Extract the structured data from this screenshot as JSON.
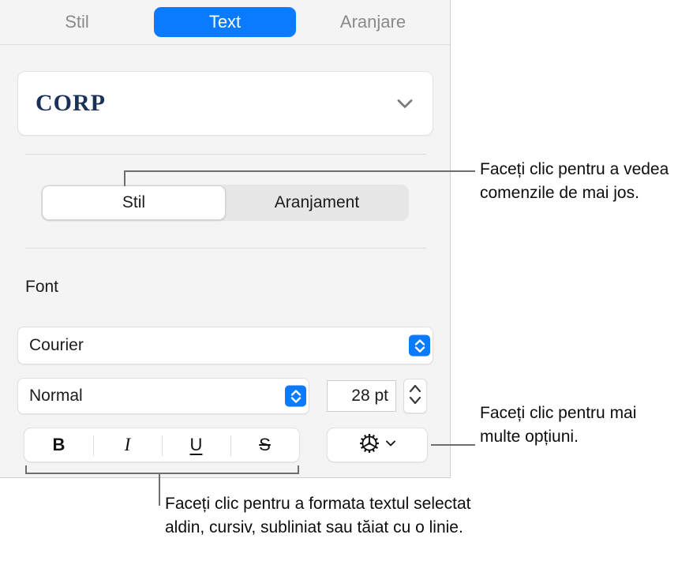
{
  "panel": {
    "tabs": [
      {
        "label": "Stil",
        "selected": false
      },
      {
        "label": "Text",
        "selected": true
      },
      {
        "label": "Aranjare",
        "selected": false
      }
    ],
    "paragraph_style": {
      "value": "CORP",
      "chevron_icon": "chevron-down-icon"
    },
    "segmented_control": [
      {
        "label": "Stil",
        "selected": true
      },
      {
        "label": "Aranjament",
        "selected": false
      }
    ],
    "font_section": {
      "heading": "Font",
      "family": "Courier",
      "style": "Normal",
      "size": "28 pt",
      "family_arrows_icon": "up-down-chevron-icon",
      "style_arrows_icon": "up-down-chevron-icon",
      "size_stepper_icon": "stepper-up-down-icon"
    },
    "text_style_buttons": [
      {
        "name": "bold",
        "glyph": "B"
      },
      {
        "name": "italic",
        "glyph": "I"
      },
      {
        "name": "underline",
        "glyph": "U"
      },
      {
        "name": "strikethrough",
        "glyph": "S"
      }
    ],
    "more_options": {
      "icon": "gear-icon",
      "chevron_icon": "chevron-down-icon"
    }
  },
  "callouts": {
    "top": "Faceți clic pentru a vedea comenzile de mai jos.",
    "right": "Faceți clic pentru mai multe opțiuni.",
    "bottom": "Faceți clic pentru a formata textul selectat aldin, cursiv, subliniat sau tăiat cu o linie."
  },
  "colors": {
    "accent_blue": "#0a7bff",
    "panel_background": "#f4f4f4",
    "corp_navy": "#1b3258",
    "leader_line": "#6e6e6e"
  }
}
